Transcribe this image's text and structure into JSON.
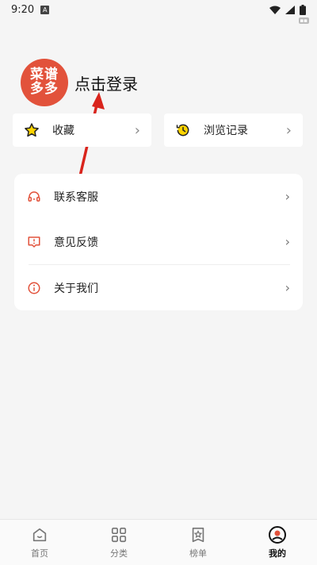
{
  "status_bar": {
    "time": "9:20",
    "notif_icon": "A"
  },
  "profile": {
    "avatar_line1": "菜谱",
    "avatar_line2": "多多",
    "login_label": "点击登录"
  },
  "quick_actions": [
    {
      "label": "收藏",
      "icon": "star-icon"
    },
    {
      "label": "浏览记录",
      "icon": "history-icon"
    }
  ],
  "menu": [
    {
      "label": "联系客服",
      "icon": "headset-icon"
    },
    {
      "label": "意见反馈",
      "icon": "feedback-icon"
    },
    {
      "label": "关于我们",
      "icon": "info-icon"
    }
  ],
  "tabs": [
    {
      "label": "首页",
      "icon": "home-icon"
    },
    {
      "label": "分类",
      "icon": "grid-icon"
    },
    {
      "label": "榜单",
      "icon": "ranking-icon"
    },
    {
      "label": "我的",
      "icon": "profile-icon",
      "active": true
    }
  ],
  "colors": {
    "accent": "#e2523b",
    "arrow": "#d9241c"
  }
}
